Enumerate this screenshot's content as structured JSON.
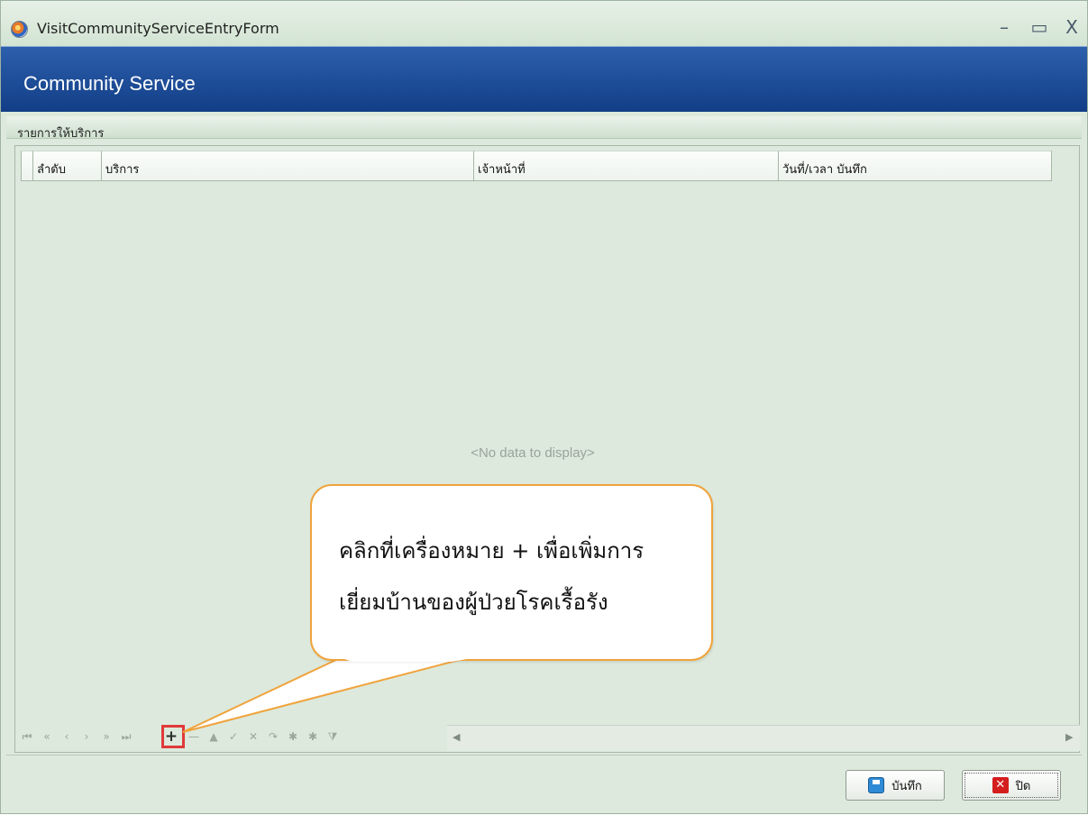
{
  "window": {
    "title": "VisitCommunityServiceEntryForm",
    "minimize": "–",
    "maximize": "▭",
    "close": "X"
  },
  "header": {
    "title": "Community Service"
  },
  "group": {
    "label": "รายการให้บริการ"
  },
  "grid": {
    "columns": [
      "ลำดับ",
      "บริการ",
      "เจ้าหน้าที่",
      "วันที่/เวลา บันทึก"
    ],
    "empty_text": "<No data to display>"
  },
  "navigator": {
    "buttons": [
      "⏮",
      "«",
      "‹",
      "›",
      "»",
      "⏭",
      "+",
      "—",
      "▲",
      "✓",
      "✕",
      "↷",
      "✱",
      "✱",
      "⧩"
    ]
  },
  "callout": {
    "line1": "คลิกที่เครื่องหมาย + เพื่อเพิ่มการ",
    "line2": "เยี่ยมบ้านของผู้ป่วยโรคเรื้อรัง"
  },
  "buttons": {
    "save_label": "บันทึก",
    "close_label": "ปิด"
  },
  "colors": {
    "accent": "#1f4f9c",
    "callout_border": "#f0a33c",
    "highlight": "#e03a3a"
  }
}
